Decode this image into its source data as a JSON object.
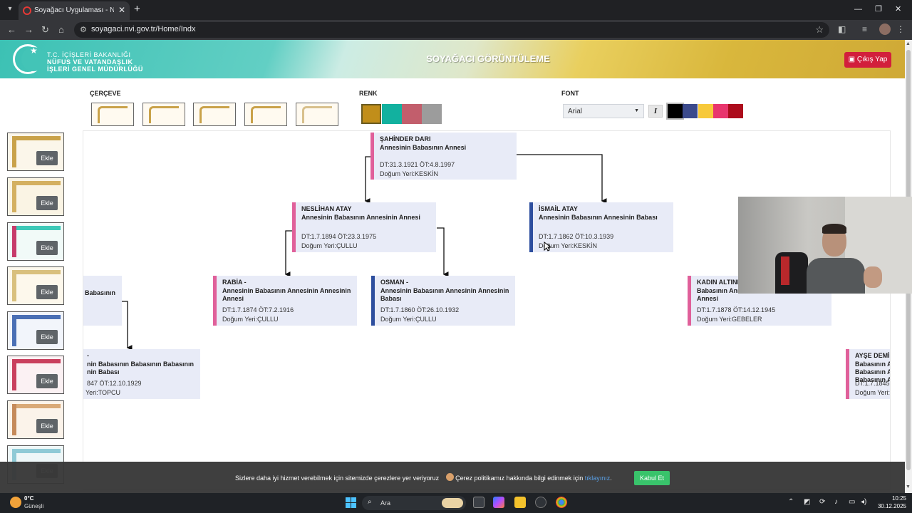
{
  "browser": {
    "tab_title": "Soyağacı Uygulaması - Nüfus ve",
    "url": "soyagaci.nvi.gov.tr/Home/Indx",
    "tab_close": "✕",
    "new_tab": "+",
    "win_minimize": "—",
    "win_restore": "❐",
    "win_close": "✕"
  },
  "header": {
    "org_line1": "T.C. İÇİŞLERİ BAKANLIĞI",
    "org_line2": "NÜFUS VE VATANDAŞLIK",
    "org_line3": "İŞLERİ GENEL MÜDÜRLÜĞÜ",
    "title": "SOYAĞACI GÖRÜNTÜLEME",
    "logout_label": "Çıkış Yap"
  },
  "toolbar": {
    "frame_label": "ÇERÇEVE",
    "color_label": "RENK",
    "font_label": "FONT",
    "font_value": "Arial",
    "italic_label": "I",
    "colors": [
      "#c18e1a",
      "#12b19f",
      "#c25e6c",
      "#9c9c9c"
    ],
    "font_colors": [
      "#000000",
      "#3b4a8c",
      "#f7c93a",
      "#e8356d",
      "#ad0c1c"
    ]
  },
  "templates": {
    "add_label": "Ekle"
  },
  "tree": {
    "nodes": [
      {
        "name": "ŞAHİNDER DARI",
        "relation": "Annesinin Babasının Annesi",
        "dates": "DT:31.3.1921 ÖT:4.8.1997",
        "birthplace": "Doğum Yeri:KESKİN"
      },
      {
        "name": "NESLİHAN ATAY",
        "relation": "Annesinin Babasının Annesinin Annesi",
        "dates": "DT:1.7.1894 ÖT:23.3.1975",
        "birthplace": "Doğum Yeri:ÇULLU"
      },
      {
        "name": "İSMAİL ATAY",
        "relation": "Annesinin Babasının Annesinin Babası",
        "dates": "DT:1.7.1862 ÖT:10.3.1939",
        "birthplace": "Doğum Yeri:KESKİN"
      },
      {
        "name": "",
        "relation": "Babasının",
        "dates": "",
        "birthplace": ""
      },
      {
        "name": "RABİA -",
        "relation": "Annesinin Babasının Annesinin Annesinin Annesi",
        "dates": "DT:1.7.1874 ÖT:7.2.1916",
        "birthplace": "Doğum Yeri:ÇULLU"
      },
      {
        "name": "OSMAN -",
        "relation": "Annesinin Babasının Annesinin Annesinin Babası",
        "dates": "DT:1.7.1860 ÖT:26.10.1932",
        "birthplace": "Doğum Yeri:ÇULLU"
      },
      {
        "name": "KADIN ALTIND",
        "relation": "Babasının Annesinin Annesinin Annesinin Annesi",
        "dates": "DT:1.7.1878 ÖT:14.12.1945",
        "birthplace": "Doğum Yeri:GEBELER"
      },
      {
        "name": "-",
        "relation": "nin Babasının Babasının Babasının nin Babası",
        "dates": "847 ÖT:12.10.1929",
        "birthplace": "Yeri:TOPCU"
      },
      {
        "name": "AYŞE DEMİ",
        "relation": "Babasının A Babasının A Babasının A",
        "dates": "DT:1.7.1845",
        "birthplace": "Doğum Yeri:"
      }
    ]
  },
  "cookie": {
    "text": "Sizlere daha iyi hizmet verebilmek için sitemizde çerezlere yer veriyoruz",
    "text2": "Çerez politikamız hakkında bilgi edinmek için",
    "link": "tıklayınız",
    "end": ".",
    "accept_label": "Kabul Et"
  },
  "taskbar": {
    "temp": "0°C",
    "weather": "Güneşli",
    "search_placeholder": "Ara",
    "time": "10:25",
    "date": "30.12.2025"
  }
}
